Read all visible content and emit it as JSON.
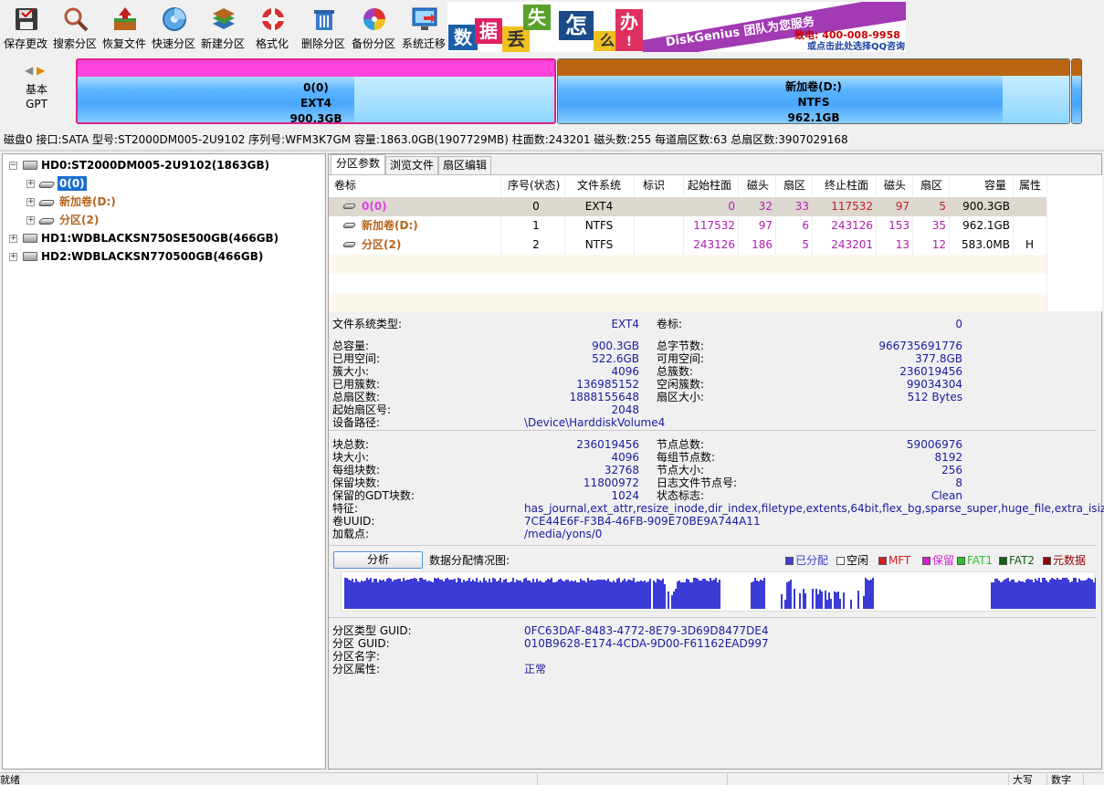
{
  "toolbar": {
    "buttons": [
      {
        "label": "保存更改",
        "icon": "save-icon"
      },
      {
        "label": "搜索分区",
        "icon": "search-icon"
      },
      {
        "label": "恢复文件",
        "icon": "recover-icon"
      },
      {
        "label": "快速分区",
        "icon": "quick-partition-icon"
      },
      {
        "label": "新建分区",
        "icon": "new-partition-icon"
      },
      {
        "label": "格式化",
        "icon": "format-icon"
      },
      {
        "label": "删除分区",
        "icon": "delete-icon"
      },
      {
        "label": "备份分区",
        "icon": "backup-icon"
      },
      {
        "label": "系统迁移",
        "icon": "migrate-icon"
      }
    ]
  },
  "banner": {
    "chars": [
      "数",
      "据",
      "丢",
      "失",
      "怎",
      "么",
      "办",
      "!"
    ],
    "slogan": "DiskGenius 团队为您服务",
    "phone": "致电: 400-008-9958",
    "qq": "或点击此处选择QQ咨询"
  },
  "diskbar": {
    "type1": "基本",
    "type2": "GPT",
    "partitions": [
      {
        "name": "0(0)",
        "fs": "EXT4",
        "size": "900.3GB",
        "color": "#ff44dd",
        "used_fraction": 0.58
      },
      {
        "name": "新加卷(D:)",
        "fs": "NTFS",
        "size": "962.1GB",
        "color": "#b86412",
        "used_fraction": 0.87
      },
      {
        "name": "",
        "fs": "",
        "size": "",
        "color": "#b86412",
        "used_fraction": 1.0
      }
    ]
  },
  "disk_info": "磁盘0 接口:SATA  型号:ST2000DM005-2U9102  序列号:WFM3K7GM  容量:1863.0GB(1907729MB)  柱面数:243201  磁头数:255  每道扇区数:63  总扇区数:3907029168",
  "tree": {
    "disk0": "HD0:ST2000DM005-2U9102(1863GB)",
    "p0": "0(0)",
    "p1": "新加卷(D:)",
    "p2": "分区(2)",
    "disk1": "HD1:WDBLACKSN750SE500GB(466GB)",
    "disk2": "HD2:WDBLACKSN770500GB(466GB)"
  },
  "tabs": [
    "分区参数",
    "浏览文件",
    "扇区编辑"
  ],
  "table": {
    "headers": [
      "卷标",
      "序号(状态)",
      "文件系统",
      "标识",
      "起始柱面",
      "磁头",
      "扇区",
      "终止柱面",
      "磁头",
      "扇区",
      "容量",
      "属性"
    ],
    "rows": [
      [
        "0(0)",
        "0",
        "EXT4",
        "",
        "0",
        "32",
        "33",
        "117532",
        "97",
        "5",
        "900.3GB",
        ""
      ],
      [
        "新加卷(D:)",
        "1",
        "NTFS",
        "",
        "117532",
        "97",
        "6",
        "243126",
        "153",
        "35",
        "962.1GB",
        ""
      ],
      [
        "分区(2)",
        "2",
        "NTFS",
        "",
        "243126",
        "186",
        "5",
        "243201",
        "13",
        "12",
        "583.0MB",
        "H"
      ]
    ]
  },
  "details": {
    "fs_type_label": "文件系统类型:",
    "fs_type": "EXT4",
    "vol_label_label": "卷标:",
    "vol_label": "0",
    "left1": [
      [
        "总容量:",
        "900.3GB"
      ],
      [
        "已用空间:",
        "522.6GB"
      ],
      [
        "簇大小:",
        "4096"
      ],
      [
        "已用簇数:",
        "136985152"
      ],
      [
        "总扇区数:",
        "1888155648"
      ],
      [
        "起始扇区号:",
        "2048"
      ],
      [
        "设备路径:",
        "\\Device\\HarddiskVolume4"
      ]
    ],
    "right1": [
      [
        "总字节数:",
        "966735691776"
      ],
      [
        "可用空间:",
        "377.8GB"
      ],
      [
        "总簇数:",
        "236019456"
      ],
      [
        "空闲簇数:",
        "99034304"
      ],
      [
        "扇区大小:",
        "512 Bytes"
      ]
    ],
    "left2": [
      [
        "块总数:",
        "236019456"
      ],
      [
        "块大小:",
        "4096"
      ],
      [
        "每组块数:",
        "32768"
      ],
      [
        "保留块数:",
        "11800972"
      ],
      [
        "保留的GDT块数:",
        "1024"
      ]
    ],
    "right2": [
      [
        "节点总数:",
        "59006976"
      ],
      [
        "每组节点数:",
        "8192"
      ],
      [
        "节点大小:",
        "256"
      ],
      [
        "日志文件节点号:",
        "8"
      ],
      [
        "状态标志:",
        "Clean"
      ]
    ],
    "features_label": "特征:",
    "features": "has_journal,ext_attr,resize_inode,dir_index,filetype,extents,64bit,flex_bg,sparse_super,huge_file,extra_isize",
    "uuid_label": "卷UUID:",
    "uuid": "7CE44E6F-F3B4-46FB-909E70BE9A744A11",
    "mount_label": "加载点:",
    "mount": "/media/yons/0",
    "analyze": "分析",
    "map_label": "数据分配情况图:",
    "legend": [
      {
        "label": "已分配",
        "color": "#4040d0"
      },
      {
        "label": "空闲",
        "color": "#ffffff"
      },
      {
        "label": "MFT",
        "color": "#d02020"
      },
      {
        "label": "保留",
        "color": "#d020d0"
      },
      {
        "label": "FAT1",
        "color": "#30c030"
      },
      {
        "label": "FAT2",
        "color": "#106010"
      },
      {
        "label": "元数据",
        "color": "#900000"
      }
    ],
    "guid": [
      [
        "分区类型 GUID:",
        "0FC63DAF-8483-4772-8E79-3D69D8477DE4"
      ],
      [
        "分区 GUID:",
        "010B9628-E174-4CDA-9D00-F61162EAD997"
      ],
      [
        "分区名字:",
        ""
      ],
      [
        "分区属性:",
        "正常"
      ]
    ]
  },
  "status": {
    "ready": "就绪",
    "caps": "大写",
    "num": "数字"
  }
}
